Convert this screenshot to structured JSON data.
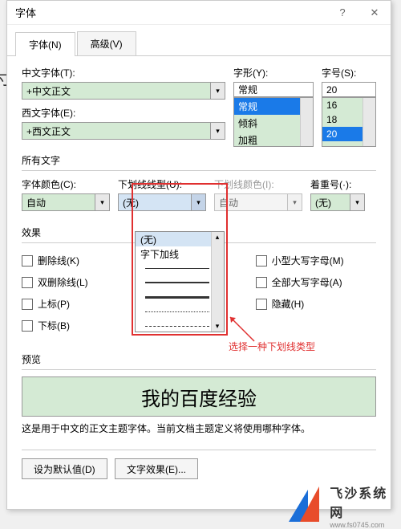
{
  "title": "字体",
  "tabs": {
    "font": "字体(N)",
    "advanced": "高级(V)"
  },
  "labels": {
    "cnfont": "中文字体(T):",
    "enfont": "西文字体(E):",
    "style": "字形(Y):",
    "size": "字号(S):",
    "allfonts": "所有文字",
    "color": "字体颜色(C):",
    "underline": "下划线线型(U):",
    "ulcolor": "下划线颜色(I):",
    "emphasis": "着重号(·):",
    "effects": "效果",
    "preview": "预览"
  },
  "values": {
    "cnfont": "+中文正文",
    "enfont": "+西文正文",
    "style": "常规",
    "size": "20",
    "color": "自动",
    "underline": "(无)",
    "ulcolor": "自动",
    "emphasis": "(无)"
  },
  "styleOptions": [
    "常规",
    "倾斜",
    "加粗"
  ],
  "sizeOptions": [
    "16",
    "18",
    "20"
  ],
  "underlineOptions": {
    "none": "(无)",
    "words": "字下加线"
  },
  "checkboxes": {
    "strike": "删除线(K)",
    "dstrike": "双删除线(L)",
    "super": "上标(P)",
    "sub": "下标(B)",
    "smallcaps": "小型大写字母(M)",
    "allcaps": "全部大写字母(A)",
    "hidden": "隐藏(H)"
  },
  "previewText": "我的百度经验",
  "note": "这是用于中文的正文主题字体。当前文档主题定义将使用哪种字体。",
  "buttons": {
    "default": "设为默认值(D)",
    "textfx": "文字效果(E)..."
  },
  "annotation": "选择一种下划线类型",
  "logo": {
    "cn": "飞沙系统网",
    "url": "www.fs0745.com"
  },
  "bgchar": "寸"
}
